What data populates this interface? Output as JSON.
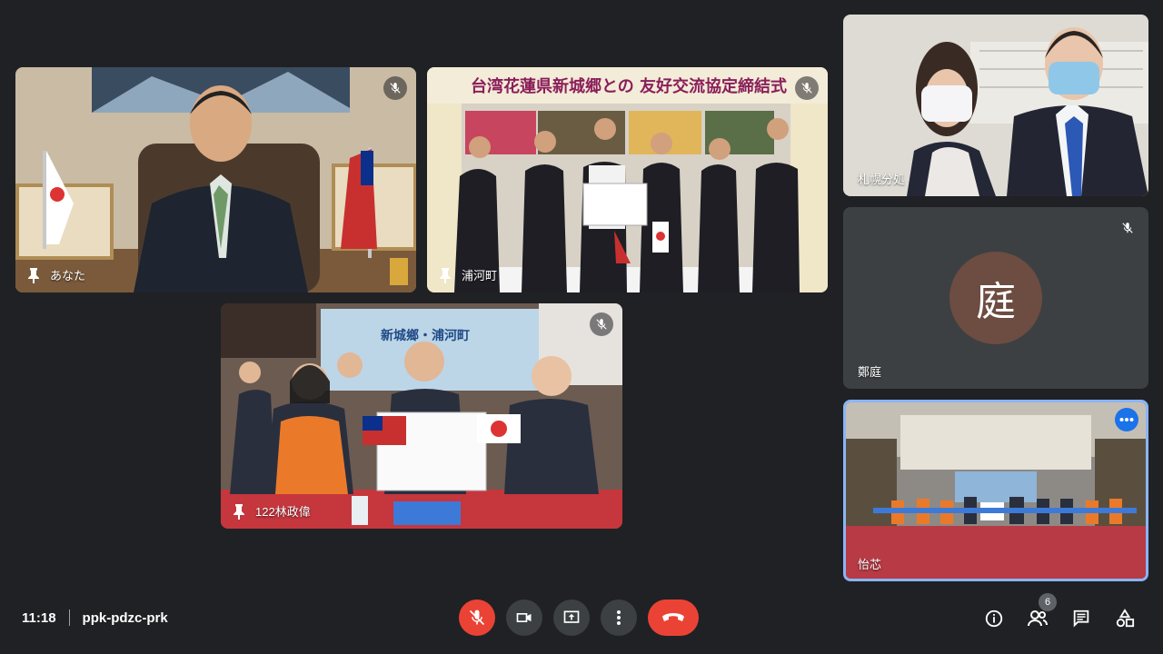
{
  "participants": [
    {
      "name": "あなた",
      "muted": true,
      "pinned": false
    },
    {
      "name": "浦河町",
      "muted": true,
      "pinned": false
    },
    {
      "name": "122林政偉",
      "muted": true,
      "pinned": false
    },
    {
      "name": "札幌分処",
      "muted": false,
      "pinned": false
    },
    {
      "name": "鄭庭",
      "muted": true,
      "avatar_letter": "庭",
      "avatar_color": "#6d4c41"
    },
    {
      "name": "怡芯",
      "muted": false,
      "selected": true
    }
  ],
  "meeting": {
    "time": "11:18",
    "code": "ppk-pdzc-prk"
  },
  "people_count": "6",
  "colors": {
    "background": "#202124",
    "control": "#3c4043",
    "end_call": "#ea4335",
    "accent": "#8ab4f8",
    "more_button": "#1a73e8"
  },
  "icons": [
    "mic-off-icon",
    "camera-icon",
    "present-icon",
    "more-vert-icon",
    "end-call-icon",
    "info-icon",
    "people-icon",
    "chat-icon",
    "activities-icon",
    "pin-icon",
    "more-horiz-icon"
  ]
}
